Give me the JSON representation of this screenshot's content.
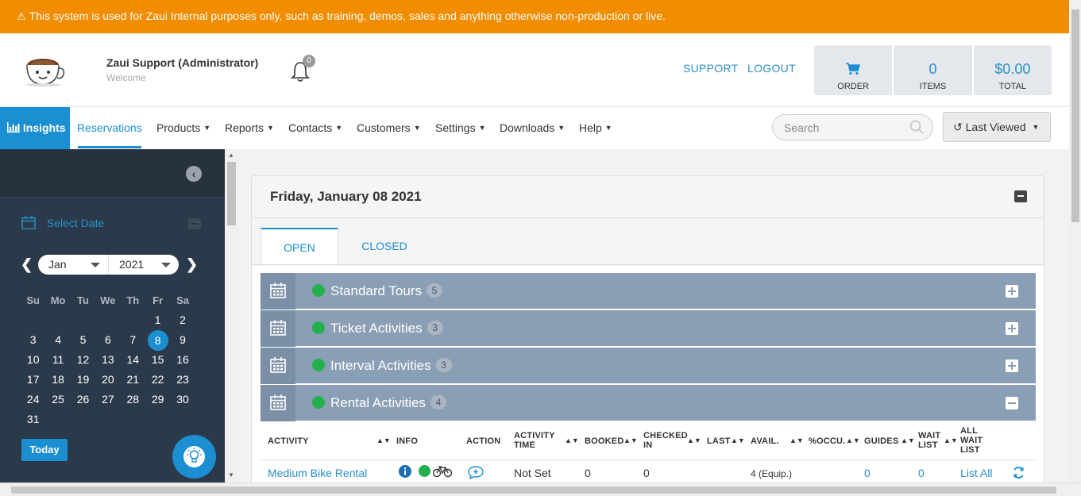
{
  "banner": {
    "text": "This system is used for Zaui Internal purposes only, such as training, demos, sales and anything otherwise non-production or live."
  },
  "header": {
    "user_name": "Zaui Support (Administrator)",
    "user_subtitle": "Welcome",
    "notification_count": "0",
    "support_label": "SUPPORT",
    "logout_label": "LOGOUT",
    "cart": {
      "order_label": "ORDER",
      "items_value": "0",
      "items_label": "ITEMS",
      "total_value": "$0.00",
      "total_label": "TOTAL"
    }
  },
  "nav": {
    "insights": "Insights",
    "items": [
      "Reservations",
      "Products",
      "Reports",
      "Contacts",
      "Customers",
      "Settings",
      "Downloads",
      "Help"
    ],
    "search_placeholder": "Search",
    "last_viewed": "Last Viewed"
  },
  "sidebar": {
    "select_date": "Select Date",
    "month": "Jan",
    "year": "2021",
    "weekdays": [
      "Su",
      "Mo",
      "Tu",
      "We",
      "Th",
      "Fr",
      "Sa"
    ],
    "weeks": [
      [
        "",
        "",
        "",
        "",
        "",
        "1",
        "2"
      ],
      [
        "3",
        "4",
        "5",
        "6",
        "7",
        "8",
        "9"
      ],
      [
        "10",
        "11",
        "12",
        "13",
        "14",
        "15",
        "16"
      ],
      [
        "17",
        "18",
        "19",
        "20",
        "21",
        "22",
        "23"
      ],
      [
        "24",
        "25",
        "26",
        "27",
        "28",
        "29",
        "30"
      ],
      [
        "31",
        "",
        "",
        "",
        "",
        "",
        ""
      ]
    ],
    "selected_day": "8",
    "today_label": "Today"
  },
  "main": {
    "date_title": "Friday, January 08 2021",
    "tabs": [
      "OPEN",
      "CLOSED"
    ],
    "categories": [
      {
        "label": "Standard Tours",
        "count": "5",
        "expanded": false
      },
      {
        "label": "Ticket Activities",
        "count": "3",
        "expanded": false
      },
      {
        "label": "Interval Activities",
        "count": "3",
        "expanded": false
      },
      {
        "label": "Rental Activities",
        "count": "4",
        "expanded": true
      }
    ],
    "table": {
      "headers": [
        "ACTIVITY",
        "INFO",
        "ACTION",
        "ACTIVITY TIME",
        "BOOKED",
        "CHECKED IN",
        "LAST",
        "AVAIL.",
        "%OCCU.",
        "GUIDES",
        "WAIT LIST",
        "ALL WAIT LIST"
      ],
      "row": {
        "activity": "Medium Bike Rental",
        "activity_time": "Not Set",
        "booked": "0",
        "checked_in": "0",
        "avail": "4",
        "avail_unit": "(Equip.)",
        "guides": "0",
        "wait_list": "0",
        "all_wait_list": "List All"
      }
    }
  },
  "colors": {
    "banner": "#f28c00",
    "accent": "#1b8fd1",
    "sidebar": "#2b3a4a",
    "category": "#8a9fb5",
    "status_green": "#22b14c"
  }
}
